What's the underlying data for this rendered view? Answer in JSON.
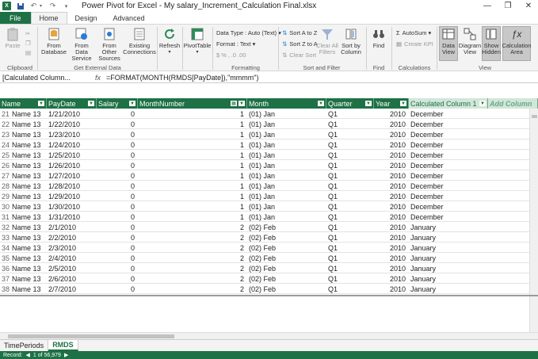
{
  "window": {
    "title": "Power Pivot for Excel - My salary_Increment_Calculation Final.xlsx",
    "app_icon": "X"
  },
  "tabs": [
    "File",
    "Home",
    "Design",
    "Advanced"
  ],
  "ribbon": {
    "clipboard": {
      "paste": "Paste",
      "label": "Clipboard"
    },
    "get_external": {
      "from_database": "From\nDatabase",
      "from_data_service": "From Data\nService",
      "from_other_sources": "From Other\nSources",
      "existing_connections": "Existing\nConnections",
      "label": "Get External Data"
    },
    "refresh": "Refresh",
    "pivottable": "PivotTable",
    "formatting": {
      "data_type": "Data Type : Auto (Text)",
      "format": "Format : Text",
      "symbols": "$  %  ‚  .0  .00",
      "label": "Formatting"
    },
    "sort_filter": {
      "sort_az": "Sort A to Z",
      "sort_za": "Sort Z to A",
      "clear_sort": "Clear Sort",
      "clear_all_filters": "Clear All\nFilters",
      "sort_by_column": "Sort by\nColumn",
      "label": "Sort and Filter"
    },
    "find": {
      "find": "Find",
      "label": "Find"
    },
    "calculations": {
      "autosum": "AutoSum",
      "create_kpi": "Create KPI",
      "label": "Calculations"
    },
    "view": {
      "data_view": "Data\nView",
      "diagram_view": "Diagram\nView",
      "show_hidden": "Show\nHidden",
      "calculation_area": "Calculation\nArea",
      "label": "View"
    }
  },
  "formula_bar": {
    "name_box": "[Calculated  Column...",
    "fx": "fx",
    "formula": "=FORMAT(MONTH(RMDS[PayDate]),\"mmmm\")"
  },
  "columns": [
    "Name",
    "PayDate",
    "Salary",
    "MonthNumber",
    "Month",
    "Quarter",
    "Year",
    "Calculated Column 1",
    "Add Column"
  ],
  "rows": [
    [
      "21",
      "Name 13",
      "1/21/2010",
      "0",
      "1",
      "(01) Jan",
      "Q1",
      "2010",
      "December"
    ],
    [
      "22",
      "Name 13",
      "1/22/2010",
      "0",
      "1",
      "(01) Jan",
      "Q1",
      "2010",
      "December"
    ],
    [
      "23",
      "Name 13",
      "1/23/2010",
      "0",
      "1",
      "(01) Jan",
      "Q1",
      "2010",
      "December"
    ],
    [
      "24",
      "Name 13",
      "1/24/2010",
      "0",
      "1",
      "(01) Jan",
      "Q1",
      "2010",
      "December"
    ],
    [
      "25",
      "Name 13",
      "1/25/2010",
      "0",
      "1",
      "(01) Jan",
      "Q1",
      "2010",
      "December"
    ],
    [
      "26",
      "Name 13",
      "1/26/2010",
      "0",
      "1",
      "(01) Jan",
      "Q1",
      "2010",
      "December"
    ],
    [
      "27",
      "Name 13",
      "1/27/2010",
      "0",
      "1",
      "(01) Jan",
      "Q1",
      "2010",
      "December"
    ],
    [
      "28",
      "Name 13",
      "1/28/2010",
      "0",
      "1",
      "(01) Jan",
      "Q1",
      "2010",
      "December"
    ],
    [
      "29",
      "Name 13",
      "1/29/2010",
      "0",
      "1",
      "(01) Jan",
      "Q1",
      "2010",
      "December"
    ],
    [
      "30",
      "Name 13",
      "1/30/2010",
      "0",
      "1",
      "(01) Jan",
      "Q1",
      "2010",
      "December"
    ],
    [
      "31",
      "Name 13",
      "1/31/2010",
      "0",
      "1",
      "(01) Jan",
      "Q1",
      "2010",
      "December"
    ],
    [
      "32",
      "Name 13",
      "2/1/2010",
      "0",
      "2",
      "(02) Feb",
      "Q1",
      "2010",
      "January"
    ],
    [
      "33",
      "Name 13",
      "2/2/2010",
      "0",
      "2",
      "(02) Feb",
      "Q1",
      "2010",
      "January"
    ],
    [
      "34",
      "Name 13",
      "2/3/2010",
      "0",
      "2",
      "(02) Feb",
      "Q1",
      "2010",
      "January"
    ],
    [
      "35",
      "Name 13",
      "2/4/2010",
      "0",
      "2",
      "(02) Feb",
      "Q1",
      "2010",
      "January"
    ],
    [
      "36",
      "Name 13",
      "2/5/2010",
      "0",
      "2",
      "(02) Feb",
      "Q1",
      "2010",
      "January"
    ],
    [
      "37",
      "Name 13",
      "2/6/2010",
      "0",
      "2",
      "(02) Feb",
      "Q1",
      "2010",
      "January"
    ],
    [
      "38",
      "Name 13",
      "2/7/2010",
      "0",
      "2",
      "(02) Feb",
      "Q1",
      "2010",
      "January"
    ]
  ],
  "sheets": [
    "TimePeriods",
    "RMDS"
  ],
  "status": {
    "record": "Record:",
    "position": "1 of 56,979"
  },
  "colors": {
    "accent": "#1e7145",
    "calc_header": "#d2e6d9"
  }
}
